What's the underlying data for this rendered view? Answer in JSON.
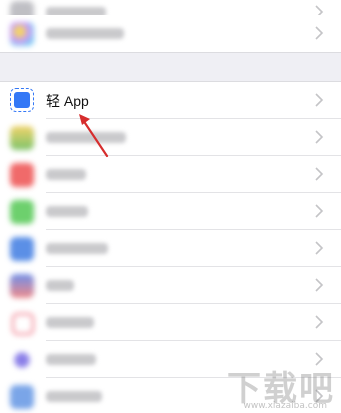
{
  "settings": {
    "top_rows": [
      {
        "icon": "blurred-app-icon",
        "color": "#bfbfc4"
      },
      {
        "icon": "game-center-icon",
        "color": "#c9a6ef"
      }
    ],
    "main_rows": [
      {
        "label": "轻 App",
        "icon": "light-app-icon",
        "color": "#3478f6",
        "highlight": true
      },
      {
        "icon": "blurred-app-icon",
        "color": "#8fcf7a"
      },
      {
        "icon": "blurred-app-icon",
        "color": "#f06a6a"
      },
      {
        "icon": "blurred-app-icon",
        "color": "#6dd06d"
      },
      {
        "icon": "blurred-app-icon",
        "color": "#5b8fe6"
      },
      {
        "icon": "blurred-app-icon",
        "color": "#6f8fe8"
      },
      {
        "icon": "blurred-app-icon",
        "color": "#f07a8a"
      },
      {
        "icon": "blurred-app-icon",
        "color": "#8b7fe8"
      },
      {
        "icon": "blurred-app-icon",
        "color": "#7aa5e8"
      }
    ]
  },
  "annotation": {
    "arrow_color": "#d62d2d"
  },
  "watermark": {
    "big": "下载吧",
    "small": "www.xiazaiba.com"
  }
}
